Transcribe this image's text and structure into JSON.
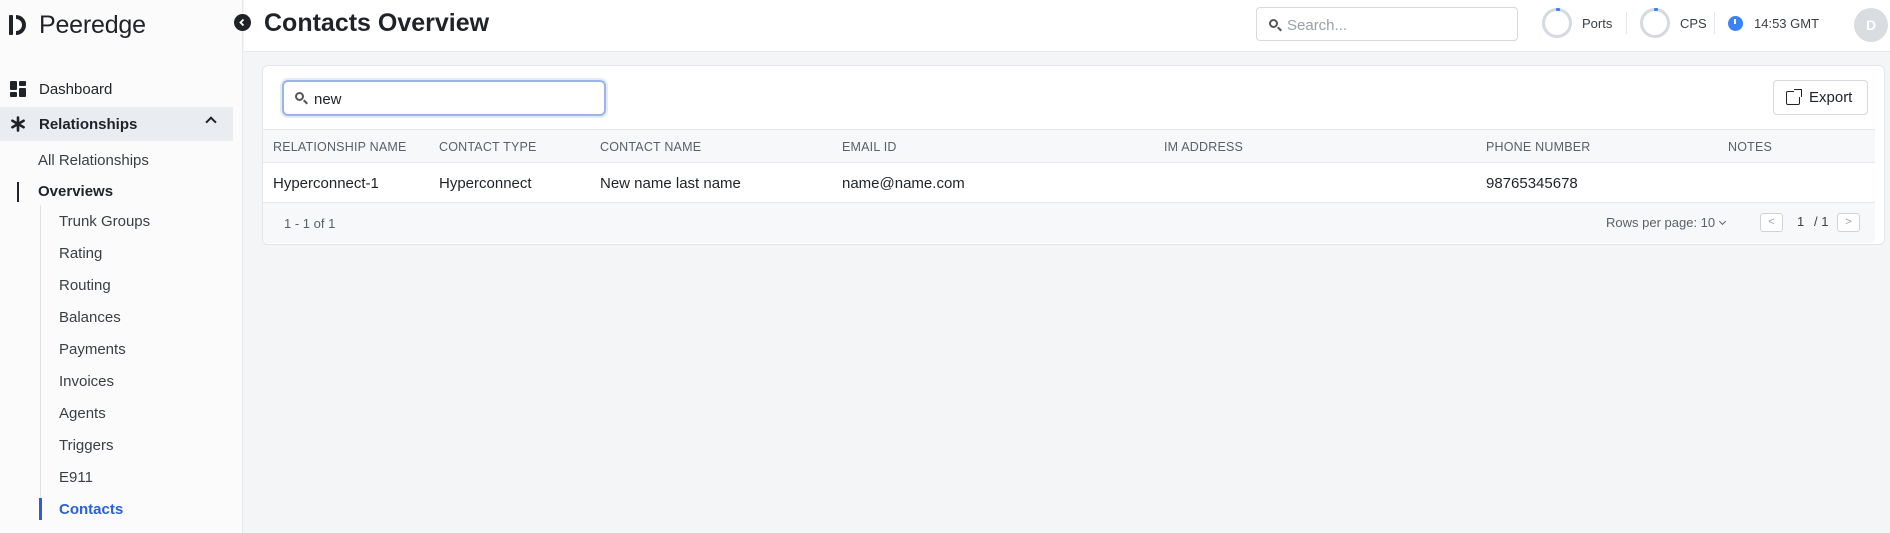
{
  "brand": {
    "name": "Peeredge"
  },
  "sidebar": {
    "dashboard": "Dashboard",
    "relationships": "Relationships",
    "sub": [
      {
        "label": "All Relationships"
      },
      {
        "label": "Overviews"
      }
    ],
    "leaves": [
      {
        "label": "Trunk Groups"
      },
      {
        "label": "Rating"
      },
      {
        "label": "Routing"
      },
      {
        "label": "Balances"
      },
      {
        "label": "Payments"
      },
      {
        "label": "Invoices"
      },
      {
        "label": "Agents"
      },
      {
        "label": "Triggers"
      },
      {
        "label": "E911"
      },
      {
        "label": "Contacts"
      }
    ]
  },
  "header": {
    "title": "Contacts Overview",
    "search_placeholder": "Search...",
    "ports_label": "Ports",
    "cps_label": "CPS",
    "time": "14:53 GMT",
    "avatar_initial": "D"
  },
  "toolbar": {
    "filter_value": "new",
    "export_label": "Export"
  },
  "table": {
    "columns": [
      "RELATIONSHIP NAME",
      "CONTACT TYPE",
      "CONTACT NAME",
      "EMAIL ID",
      "IM ADDRESS",
      "PHONE NUMBER",
      "NOTES"
    ],
    "rows": [
      [
        "Hyperconnect-1",
        "Hyperconnect",
        "New name last name",
        "name@name.com",
        "",
        "98765345678",
        ""
      ]
    ]
  },
  "pagination": {
    "range": "1 - 1 of 1",
    "rows_per_page": "Rows per page: 10",
    "page": "1",
    "total": "/ 1"
  },
  "colors": {
    "accent": "#2b5fd9",
    "gauge": "#3b82f6"
  }
}
